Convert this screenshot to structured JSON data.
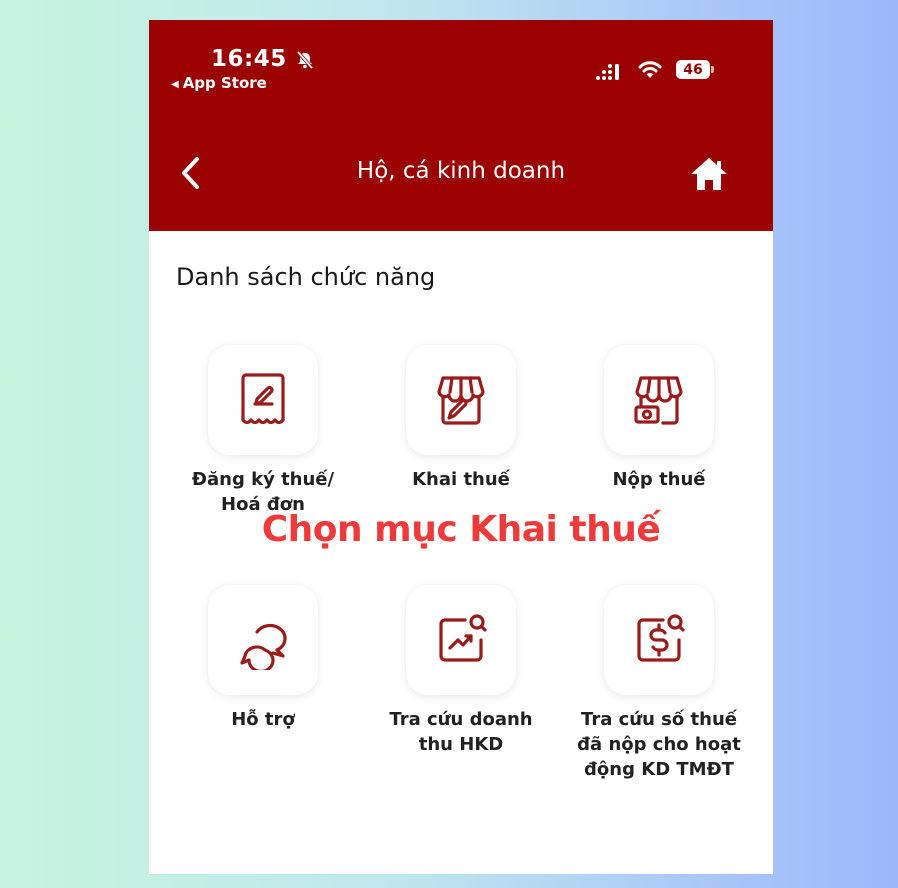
{
  "status_bar": {
    "time": "16:45",
    "back_app_label": "App Store",
    "battery": "46"
  },
  "header": {
    "title": "Hộ, cá kinh doanh",
    "background": "#9b0303"
  },
  "main": {
    "section_title": "Danh sách chức năng",
    "annotation": "Chọn mục Khai thuế",
    "annotation_color": "#ee3a3a",
    "tiles": [
      {
        "label": "Đăng ký thuế/\nHoá đơn",
        "icon": "receipt-edit-icon"
      },
      {
        "label": "Khai thuế",
        "icon": "store-edit-icon"
      },
      {
        "label": "Nộp thuế",
        "icon": "store-money-icon"
      },
      {
        "label": "Hỗ trợ",
        "icon": "chat-bubbles-icon"
      },
      {
        "label": "Tra cứu doanh\nthu HKD",
        "icon": "chart-search-icon"
      },
      {
        "label": "Tra cứu số thuế\nđã nộp cho hoạt\nđộng KD TMĐT",
        "icon": "dollar-search-icon"
      }
    ]
  },
  "icon_color": "#9b1b1b"
}
